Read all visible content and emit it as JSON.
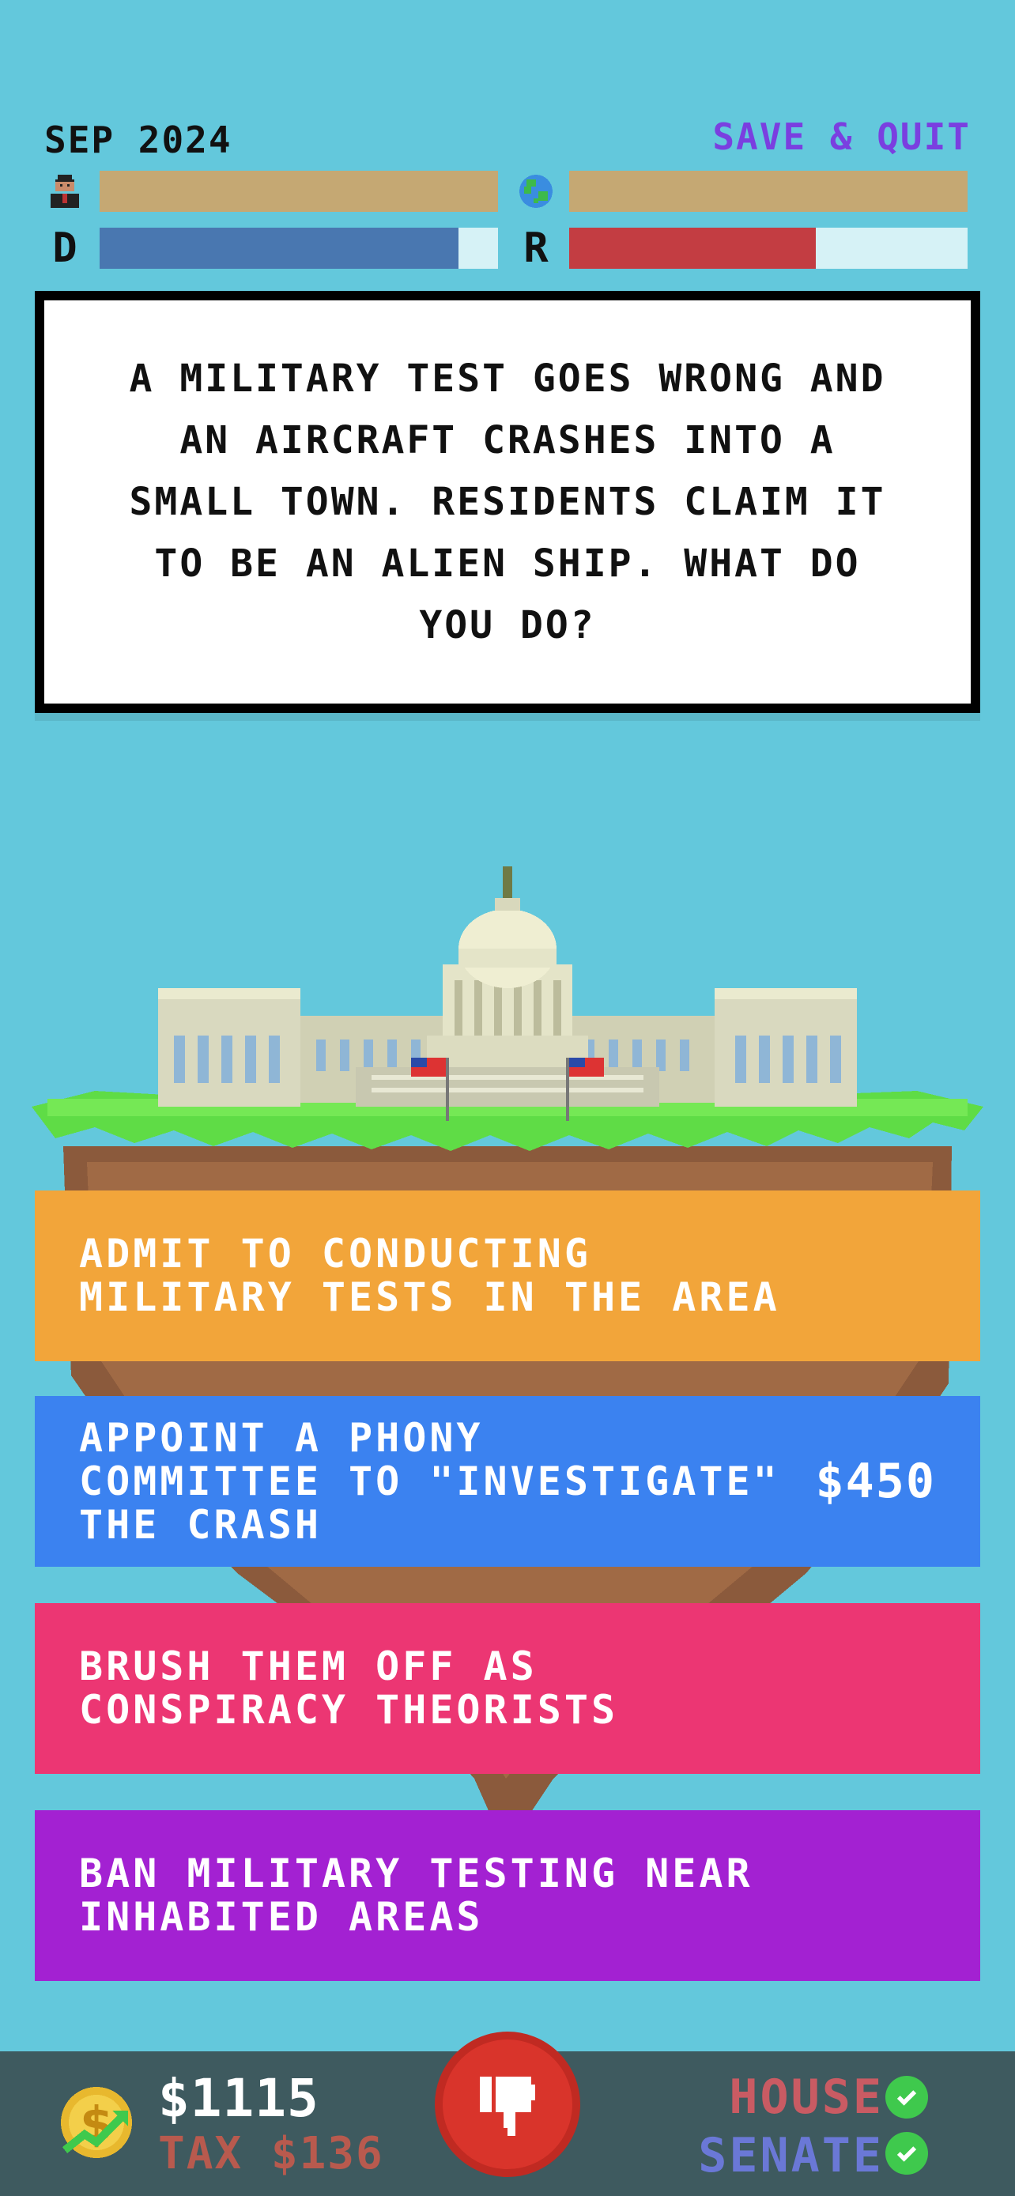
{
  "header": {
    "date": "SEP 2024",
    "save_quit": "SAVE & QUIT"
  },
  "meters": {
    "population_icon": "person-icon",
    "world_icon": "globe-icon",
    "population_level": 1.0,
    "world_level": 1.0,
    "democrat_label": "D",
    "republican_label": "R",
    "democrat_level": 0.9,
    "republican_level": 0.62
  },
  "prompt": {
    "text": "A MILITARY TEST GOES WRONG AND AN AIRCRAFT CRASHES INTO A SMALL TOWN. RESIDENTS CLAIM IT TO BE AN ALIEN SHIP. WHAT DO YOU DO?"
  },
  "choices": [
    {
      "label": "ADMIT TO CONDUCTING\nMILITARY TESTS IN THE AREA",
      "cost": "",
      "color": "#f2a53a"
    },
    {
      "label": "APPOINT A PHONY\nCOMMITTEE TO \"INVESTIGATE\"\nTHE CRASH",
      "cost": "$450",
      "color": "#3b82f0"
    },
    {
      "label": "BRUSH THEM OFF AS\nCONSPIRACY THEORISTS",
      "cost": "",
      "color": "#ec3673"
    },
    {
      "label": "BAN MILITARY TESTING NEAR\nINHABITED AREAS",
      "cost": "",
      "color": "#a321d2"
    }
  ],
  "footer": {
    "money": "$1115",
    "tax": "TAX $136",
    "house": "HOUSE",
    "senate": "SENATE",
    "coin_icon": "coin-dollar-icon",
    "veto_icon": "thumbs-down-icon",
    "check_icon": "check-icon"
  },
  "colors": {
    "background": "#63c8dc",
    "democrat": "#4977b0",
    "republican": "#c33d42",
    "approval": "#c5a873",
    "save_quit": "#7a3fe0"
  }
}
